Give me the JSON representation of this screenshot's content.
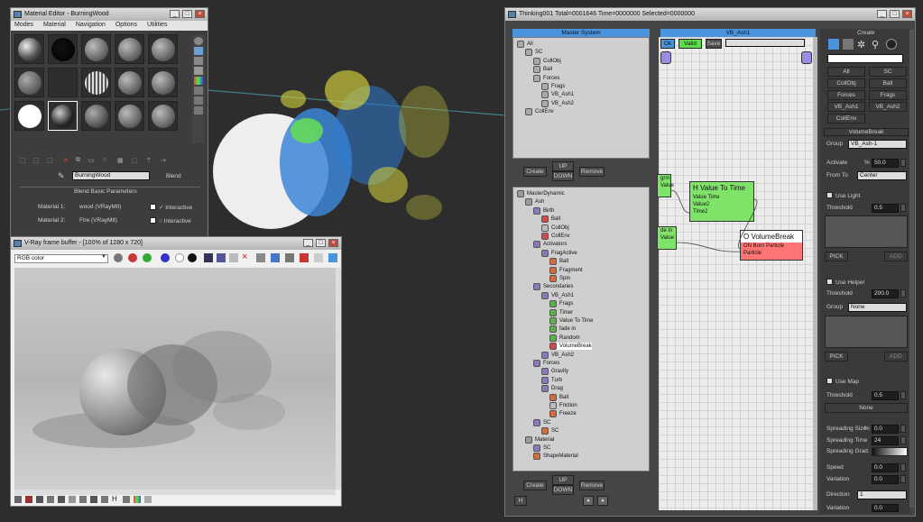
{
  "material_editor": {
    "title": "Material Editor - BurningWood",
    "menu": [
      "Modes",
      "Material",
      "Navigation",
      "Options",
      "Utilities"
    ],
    "material_name": "BurningWood",
    "type_label": "Blend",
    "rollout_title": "Blend Basic Parameters",
    "material1_label": "Material 1:",
    "material1_value": "wood (VRayMtl)",
    "material2_label": "Fire (VRayMtl)",
    "material2_row_label": "Material 2:",
    "interactive": "Interactive"
  },
  "vfb": {
    "title": "V-Ray frame buffer - [100% of 1280 x 720]",
    "channel": "RGB color"
  },
  "particle_view": {
    "title": "Thinking001  Total=0001646  Time=0000000  Selected=0000000",
    "master_system": {
      "header": "Master System",
      "items": [
        {
          "label": "All",
          "indent": 0,
          "color": "#aaa"
        },
        {
          "label": "SC",
          "indent": 1,
          "color": "#aaa"
        },
        {
          "label": "CollObj",
          "indent": 2,
          "color": "#aaa"
        },
        {
          "label": "Ball",
          "indent": 2,
          "color": "#aaa"
        },
        {
          "label": "Forces",
          "indent": 2,
          "color": "#aaa"
        },
        {
          "label": "Frags",
          "indent": 3,
          "color": "#aaa"
        },
        {
          "label": "VB_Ash1",
          "indent": 3,
          "color": "#aaa"
        },
        {
          "label": "VB_Ash2",
          "indent": 3,
          "color": "#aaa"
        },
        {
          "label": "CollEnv",
          "indent": 1,
          "color": "#aaa"
        }
      ],
      "create": "Create",
      "up": "UP",
      "down": "DOWN",
      "remove": "Remove"
    },
    "master_dynamic": {
      "items": [
        {
          "label": "MasterDynamic",
          "indent": 0,
          "color": "#9a9a9a"
        },
        {
          "label": "Ash",
          "indent": 1,
          "color": "#9a9a9a"
        },
        {
          "label": "Birth",
          "indent": 2,
          "color": "#8a78b8"
        },
        {
          "label": "Ball",
          "indent": 3,
          "color": "#d24a4a"
        },
        {
          "label": "CollObj",
          "indent": 3,
          "color": "#bbbbbb"
        },
        {
          "label": "CollEnv",
          "indent": 3,
          "color": "#d24a4a"
        },
        {
          "label": "Activators",
          "indent": 2,
          "color": "#8a78b8"
        },
        {
          "label": "FragActive",
          "indent": 3,
          "color": "#8a78b8"
        },
        {
          "label": "Ball",
          "indent": 4,
          "color": "#d26c3a"
        },
        {
          "label": "Fragment",
          "indent": 4,
          "color": "#d26c3a"
        },
        {
          "label": "Spin",
          "indent": 4,
          "color": "#d26c3a"
        },
        {
          "label": "Secondaries",
          "indent": 2,
          "color": "#8a78b8"
        },
        {
          "label": "VB_Ash1",
          "indent": 3,
          "color": "#8a78b8"
        },
        {
          "label": "Frags",
          "indent": 4,
          "color": "#59b34a"
        },
        {
          "label": "Timer",
          "indent": 4,
          "color": "#59b34a"
        },
        {
          "label": "Value To Time",
          "indent": 4,
          "color": "#59b34a"
        },
        {
          "label": "fade in",
          "indent": 4,
          "color": "#59b34a"
        },
        {
          "label": "Random",
          "indent": 4,
          "color": "#59b34a"
        },
        {
          "label": "VolumeBreak",
          "indent": 4,
          "color": "#d24a4a",
          "selected": true
        },
        {
          "label": "VB_Ash2",
          "indent": 3,
          "color": "#8a78b8"
        },
        {
          "label": "Forces",
          "indent": 2,
          "color": "#8a78b8"
        },
        {
          "label": "Gravity",
          "indent": 3,
          "color": "#8a78b8"
        },
        {
          "label": "Turb",
          "indent": 3,
          "color": "#8a78b8"
        },
        {
          "label": "Drag",
          "indent": 3,
          "color": "#8a78b8"
        },
        {
          "label": "Ball",
          "indent": 4,
          "color": "#d26c3a"
        },
        {
          "label": "Friction",
          "indent": 4,
          "color": "#bbbbbb"
        },
        {
          "label": "Freeze",
          "indent": 4,
          "color": "#d26c3a"
        },
        {
          "label": "SC",
          "indent": 2,
          "color": "#8a78b8"
        },
        {
          "label": "SC",
          "indent": 3,
          "color": "#d26c3a"
        },
        {
          "label": "Material",
          "indent": 1,
          "color": "#9a9a9a"
        },
        {
          "label": "SC",
          "indent": 2,
          "color": "#8a78b8"
        },
        {
          "label": "ShapeMaterial",
          "indent": 2,
          "color": "#d26c3a"
        }
      ],
      "create": "Create",
      "up": "UP",
      "down": "DOWN",
      "remove": "Remove",
      "hide": "H"
    },
    "graph": {
      "header": "VB_Ash1",
      "toolbar": [
        "Ok",
        "Valid",
        "Save"
      ],
      "nodes": {
        "value_to_time": {
          "title": "H Value To Time",
          "rows": [
            "Value    Time",
            "Value2",
            "Time2"
          ]
        },
        "volume_break": {
          "title": "O VolumeBreak",
          "rows": [
            "ON          Born Particle",
            "Particle"
          ]
        },
        "partial_top": {
          "rows": [
            "grm",
            "Value"
          ]
        },
        "partial_fade": {
          "rows": [
            "de in",
            "Value"
          ]
        }
      }
    },
    "command_panel": {
      "header": "Create",
      "buttons": [
        "All",
        "SC",
        "CollObj",
        "Ball",
        "Forces",
        "Frags",
        "VB_Ash1",
        "VB_Ash2",
        "CollEnv"
      ],
      "rollout": "VolumeBreak",
      "group_label": "Group",
      "group_value": "VB_Ash-1",
      "activate_label": "Activate",
      "activate_unit": "%",
      "activate_value": "50.0",
      "from_to_label": "From To",
      "from_to_value": "Center",
      "use_light": "Use Light",
      "threshold_label": "Threshold",
      "threshold1_value": "0.5",
      "pick": "PICK",
      "add": "ADD",
      "use_helper": "Use Helper",
      "threshold2_value": "200.0",
      "group2_label": "Group",
      "group2_value": "None",
      "use_map": "Use Map",
      "threshold3_value": "0.5",
      "none_label": "None",
      "spreading_size_label": "Spreading Size",
      "spreading_size_value": "0.0",
      "spreading_time_label": "Spreading Time",
      "spreading_time_value": "24",
      "spreading_grad_label": "Spreading Grad.",
      "speed_label": "Speed",
      "speed_value": "0.0",
      "variation_label": "Variation",
      "variation_value": "0.0",
      "direction_label": "Direction",
      "direction_value": "1",
      "variation2_label": "Variation",
      "variation2_value": "0.0"
    }
  },
  "colors": {
    "accent_blue": "#4a93dd",
    "node_green": "#7fe36a",
    "node_red": "#ff7474",
    "viewport_bg": "#2d2d2d"
  }
}
